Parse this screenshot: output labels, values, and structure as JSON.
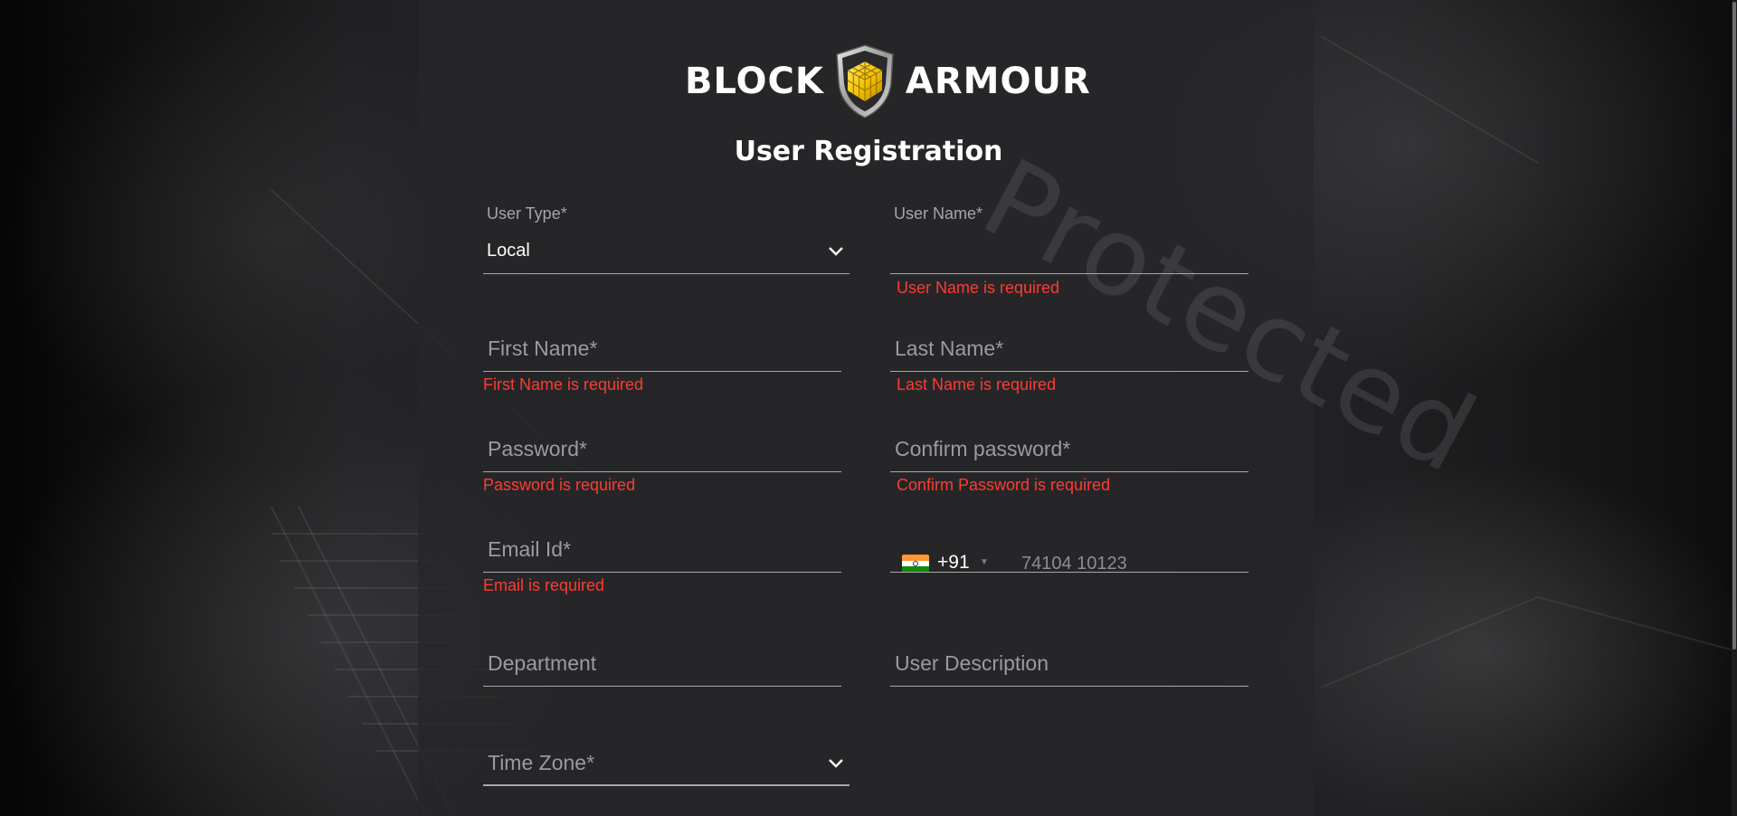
{
  "brand": {
    "left_text": "BLOCK",
    "right_text": "ARMOUR",
    "watermark": "Protected"
  },
  "page_title": "User Registration",
  "form": {
    "user_type": {
      "label": "User Type*",
      "value": "Local"
    },
    "user_name": {
      "label": "User Name*",
      "value": "",
      "error": "User Name is required"
    },
    "first_name": {
      "placeholder": "First Name*",
      "error": "First Name is required"
    },
    "last_name": {
      "placeholder": "Last Name*",
      "error": "Last Name is required"
    },
    "password": {
      "placeholder": "Password*",
      "error": "Password is required"
    },
    "confirm_password": {
      "placeholder": "Confirm password*",
      "error": "Confirm Password is required"
    },
    "email": {
      "placeholder": "Email Id*",
      "error": "Email is required"
    },
    "phone": {
      "dial_code": "+91",
      "placeholder": "74104 10123",
      "country": "India"
    },
    "department": {
      "placeholder": "Department"
    },
    "user_description": {
      "placeholder": "User Description"
    },
    "time_zone": {
      "placeholder": "Time Zone*"
    }
  },
  "colors": {
    "error": "#ff3b30",
    "panel": "#262629",
    "brand_gold": "#f2c200"
  }
}
